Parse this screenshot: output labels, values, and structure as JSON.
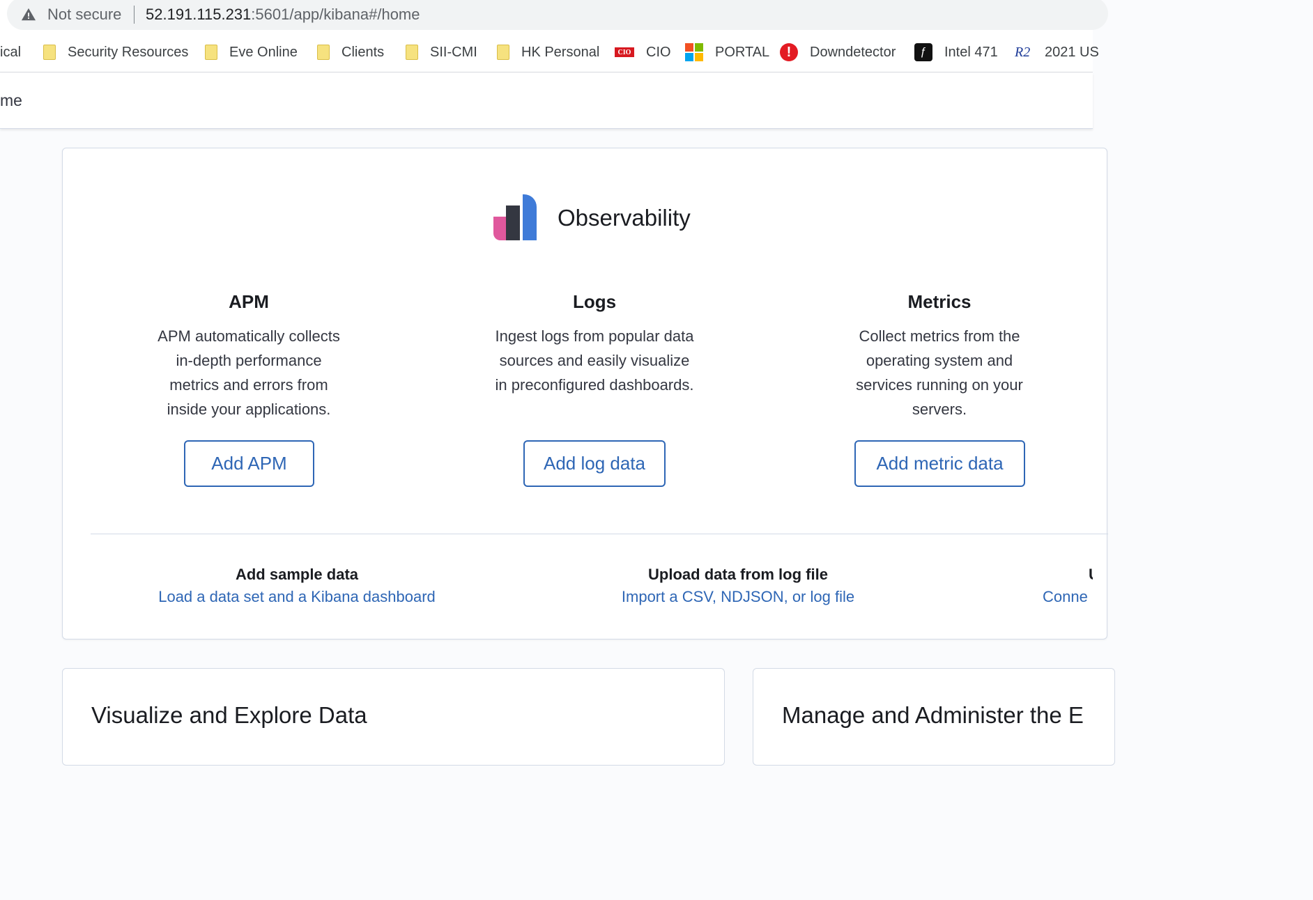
{
  "browser": {
    "security_label": "Not secure",
    "url_host": "52.191.115.231",
    "url_rest": ":5601/app/kibana#/home",
    "bookmarks": [
      {
        "label": "ical",
        "icon": "none"
      },
      {
        "label": "Security Resources",
        "icon": "folder-icon"
      },
      {
        "label": "Eve Online",
        "icon": "folder-icon"
      },
      {
        "label": "Clients",
        "icon": "folder-icon"
      },
      {
        "label": "SII-CMI",
        "icon": "folder-icon"
      },
      {
        "label": "HK Personal",
        "icon": "folder-icon"
      },
      {
        "label": "CIO",
        "icon": "cio-icon",
        "icon_text": "CIO"
      },
      {
        "label": "PORTAL",
        "icon": "microsoft-icon"
      },
      {
        "label": "Downdetector",
        "icon": "downdetector-icon",
        "icon_text": "!"
      },
      {
        "label": "Intel 471",
        "icon": "intel471-icon"
      },
      {
        "label": "2021 US",
        "icon": "r2-icon",
        "icon_text": "R2"
      }
    ]
  },
  "header": {
    "breadcrumb": "me"
  },
  "observability": {
    "title": "Observability",
    "colors": {
      "pink": "#e0589d",
      "dark": "#343741",
      "blue": "#3f7bd8"
    },
    "columns": [
      {
        "title": "APM",
        "description": "APM automatically collects in-depth performance metrics and errors from inside your applications.",
        "lines": [
          "APM automatically collects",
          "in-depth performance",
          "metrics and errors from",
          "inside your applications."
        ],
        "button": "Add APM"
      },
      {
        "title": "Logs",
        "description": "Ingest logs from popular data sources and easily visualize in preconfigured dashboards.",
        "lines": [
          "Ingest logs from popular data",
          "sources and easily visualize",
          "in preconfigured dashboards."
        ],
        "button": "Add log data"
      },
      {
        "title": "Metrics",
        "description": "Collect metrics from the operating system and services running on your servers.",
        "lines": [
          "Collect metrics from the",
          "operating system and",
          "services running on your",
          "servers."
        ],
        "button": "Add metric data"
      }
    ],
    "footer": [
      {
        "title": "Add sample data",
        "link": "Load a data set and a Kibana dashboard"
      },
      {
        "title": "Upload data from log file",
        "link": "Import a CSV, NDJSON, or log file"
      },
      {
        "title": "U",
        "link": "Conne"
      }
    ]
  },
  "sections": {
    "visualize_title": "Visualize and Explore Data",
    "manage_title": "Manage and Administer the E"
  }
}
